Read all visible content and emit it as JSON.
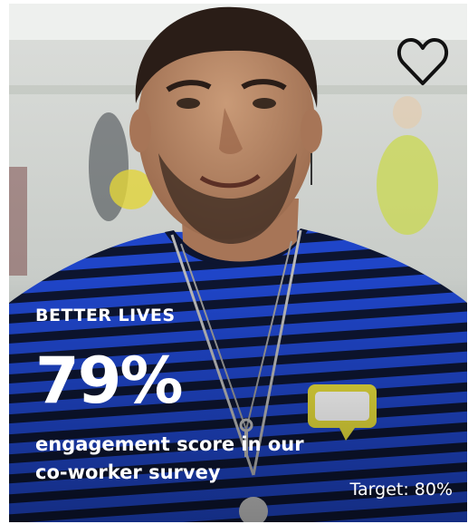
{
  "card": {
    "eyebrow": "BETTER LIVES",
    "metric_value": "79%",
    "metric_caption": "engagement score in our co-worker survey",
    "target_text": "Target: 80%"
  },
  "icons": {
    "favorite": "heart-outline-icon"
  },
  "colors": {
    "stripe_blue": "#1f45c8",
    "stripe_dark": "#0d1530",
    "text": "#ffffff",
    "badge_yellow": "#e6dd3c"
  }
}
